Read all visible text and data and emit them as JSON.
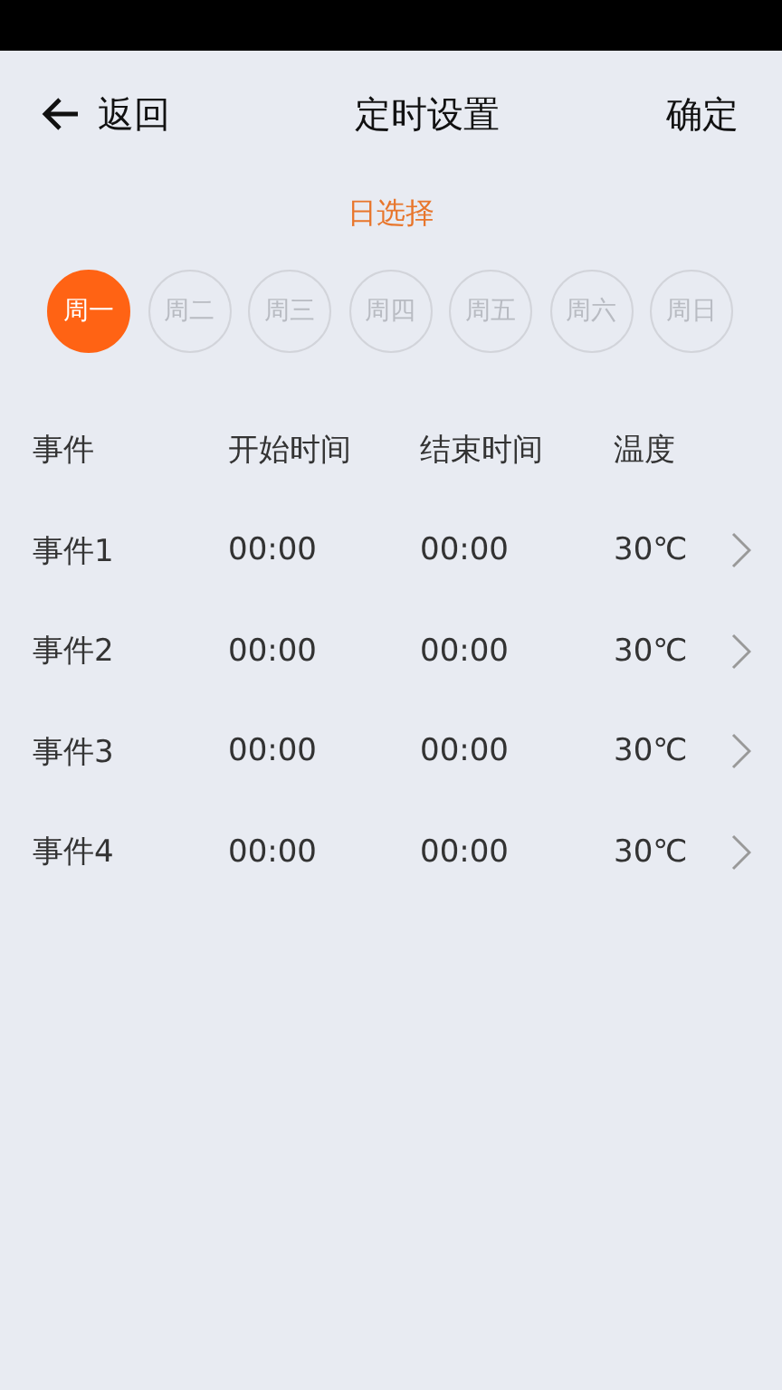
{
  "header": {
    "back_label": "返回",
    "title": "定时设置",
    "confirm_label": "确定"
  },
  "day_picker": {
    "title": "日选择",
    "days": [
      {
        "label": "周一",
        "selected": true
      },
      {
        "label": "周二",
        "selected": false
      },
      {
        "label": "周三",
        "selected": false
      },
      {
        "label": "周四",
        "selected": false
      },
      {
        "label": "周五",
        "selected": false
      },
      {
        "label": "周六",
        "selected": false
      },
      {
        "label": "周日",
        "selected": false
      }
    ]
  },
  "table": {
    "columns": [
      "事件",
      "开始时间",
      "结束时间",
      "温度"
    ],
    "rows": [
      {
        "event": "事件1",
        "start": "00:00",
        "end": "00:00",
        "temperature": "30℃"
      },
      {
        "event": "事件2",
        "start": "00:00",
        "end": "00:00",
        "temperature": "30℃"
      },
      {
        "event": "事件3",
        "start": "00:00",
        "end": "00:00",
        "temperature": "30℃"
      },
      {
        "event": "事件4",
        "start": "00:00",
        "end": "00:00",
        "temperature": "30℃"
      }
    ]
  }
}
